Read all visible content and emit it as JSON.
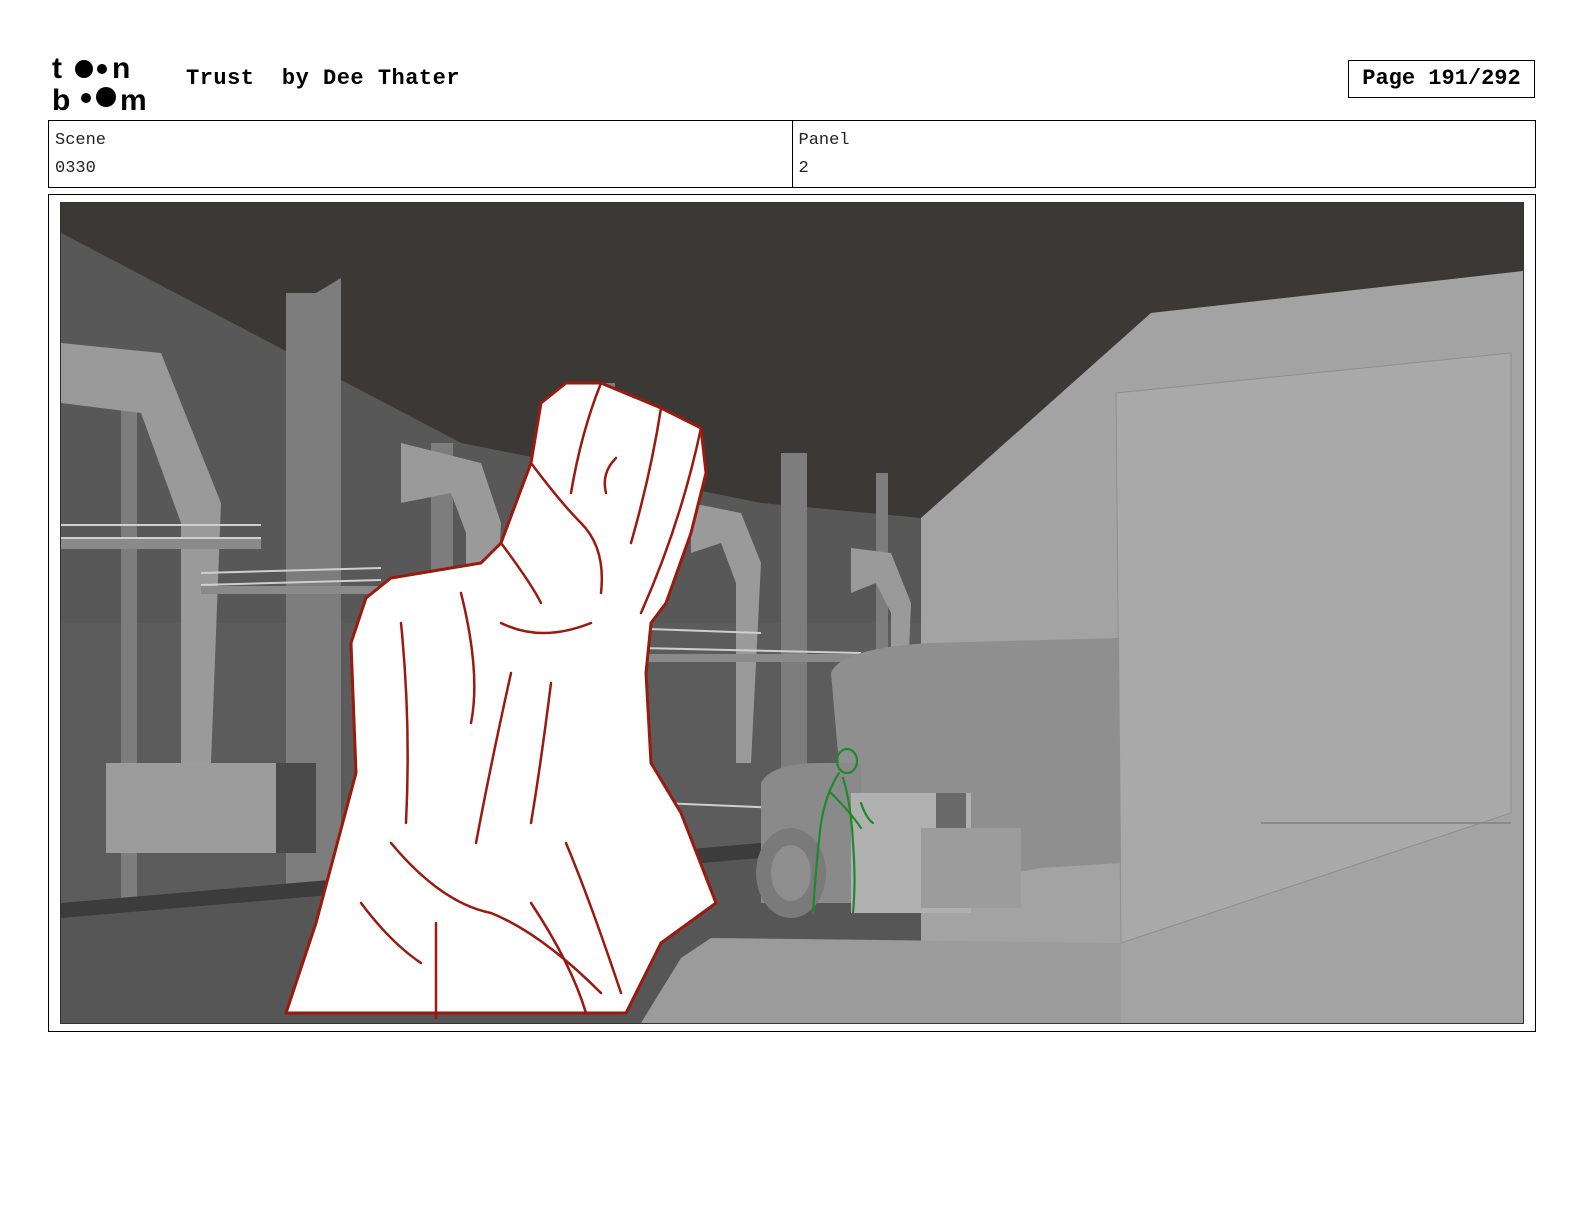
{
  "header": {
    "logo_top": "toon",
    "logo_bottom": "boom",
    "title": "Trust  by Dee Thater",
    "page_label": "Page 191/292"
  },
  "info": {
    "scene_label": "Scene",
    "scene_value": "0330",
    "panel_label": "Panel",
    "panel_value": "2"
  },
  "panel_image": {
    "description_icon": "storyboard-frame-icon",
    "colors": {
      "ceiling": "#3a3835",
      "wall": "#5a5a5a",
      "floor": "#555555",
      "truck": "#8a8a8a",
      "sketch_red": "#9a1a0e",
      "sketch_green": "#1e8a2a"
    }
  }
}
